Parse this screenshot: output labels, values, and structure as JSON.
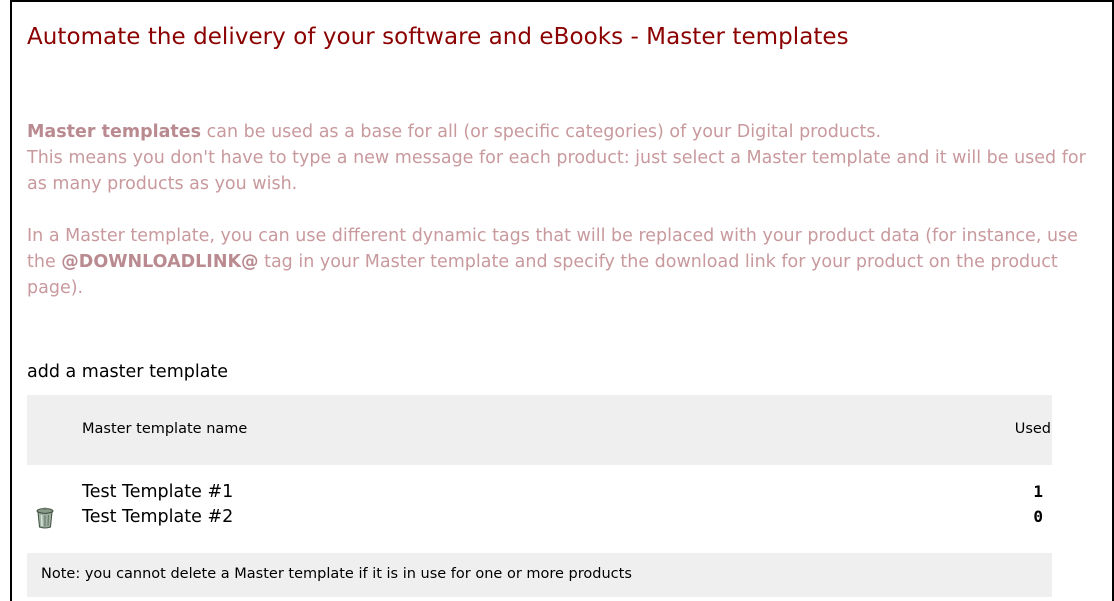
{
  "header": {
    "title": "Automate the delivery of your software and eBooks - Master templates"
  },
  "intro": {
    "p1_bold": "Master templates",
    "p1_rest": " can be used as a base for all (or specific categories) of your Digital products.",
    "p2": "This means you don't have to type a new message for each product: just select a Master template and it will be used for as many products as you wish.",
    "p3_before": "In a Master template, you can use different dynamic tags that will be replaced with your product data (for instance, use the ",
    "p3_tag": "@DOWNLOADLINK@",
    "p3_after": " tag in your Master template and specify the download link for your product on the product page)."
  },
  "actions": {
    "add_label": "add a master template"
  },
  "table": {
    "headers": {
      "name": "Master template name",
      "used": "Used"
    },
    "rows": [
      {
        "name": "Test Template #1",
        "used": "1",
        "deletable": false
      },
      {
        "name": "Test Template #2",
        "used": "0",
        "deletable": true,
        "delete_icon": "trash-icon"
      }
    ],
    "note": "Note: you cannot delete a Master template if it is in use for one or more products"
  },
  "colors": {
    "title": "#8b0000",
    "intro_text": "#c8999d",
    "table_bg": "#efefef"
  }
}
